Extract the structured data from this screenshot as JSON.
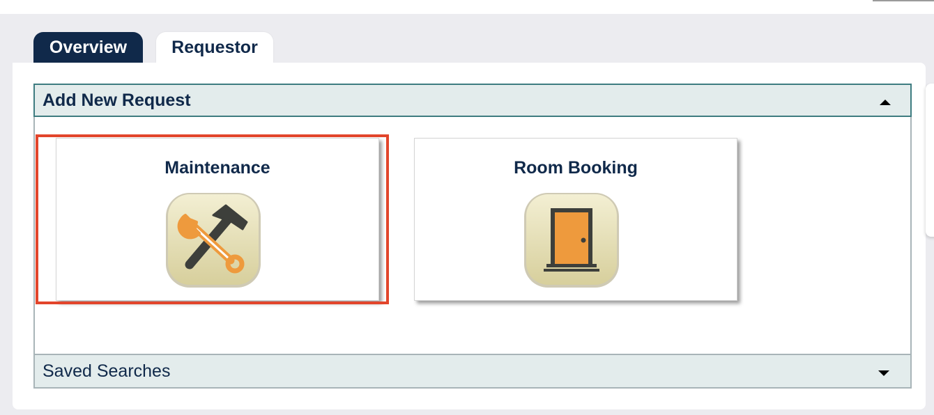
{
  "tabs": [
    {
      "label": "Overview",
      "active": true
    },
    {
      "label": "Requestor",
      "active": false
    }
  ],
  "add_new_request": {
    "title": "Add New Request",
    "tiles": [
      {
        "label": "Maintenance",
        "icon": "wrench-hammer-icon",
        "selected": true
      },
      {
        "label": "Room Booking",
        "icon": "door-icon",
        "selected": false
      }
    ]
  },
  "saved_searches": {
    "title": "Saved Searches"
  },
  "colors": {
    "tab_active": "#10294a",
    "header_bg": "#e3ecec",
    "highlight": "#e2452b",
    "icon_orange": "#ee9a3d",
    "icon_bg": "#e6e0b8"
  }
}
